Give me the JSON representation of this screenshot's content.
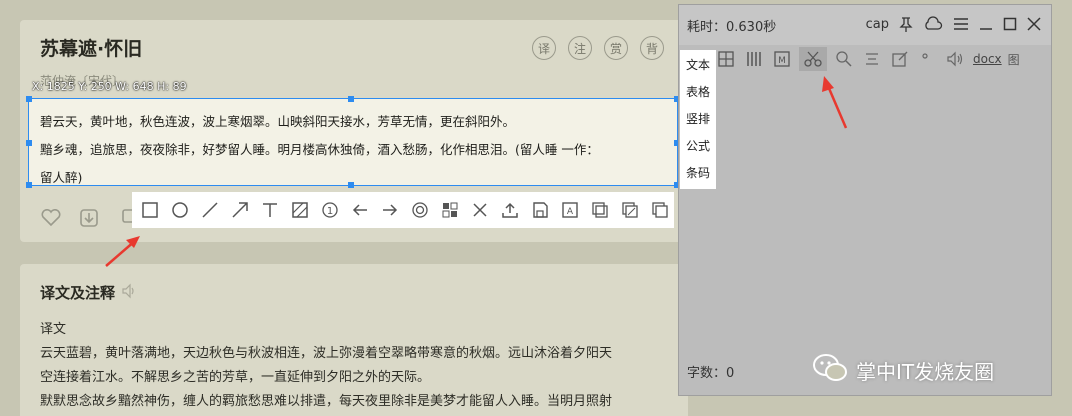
{
  "poem": {
    "title": "苏幕遮·怀旧",
    "author": "范仲淹〔宋代〕",
    "buttons": [
      "译",
      "注",
      "赏",
      "背"
    ],
    "selection_info": "X: 1825 Y: 250 W: 648 H: 89",
    "lines": [
      "碧云天，黄叶地，秋色连波，波上寒烟翠。山映斜阳天接水，芳草无情，更在斜阳外。",
      "黯乡魂，追旅思，夜夜除非，好梦留人睡。明月楼高休独倚，酒入愁肠，化作相思泪。(留人睡 一作：",
      "留人醉)"
    ]
  },
  "translation": {
    "title": "译文及注释",
    "lines": [
      "译文",
      "云天蓝碧，黄叶落满地，天边秋色与秋波相连，波上弥漫着空翠略带寒意的秋烟。远山沐浴着夕阳天",
      "空连接着江水。不解思乡之苦的芳草，一直延伸到夕阳之外的天际。",
      "默默思念故乡黯然神伤，缠人的羁旅愁思难以排遣，每天夜里除非是美梦才能留人入睡。当明月照射"
    ]
  },
  "capture": {
    "time": "耗时：0.630秒",
    "cap_label": "cap",
    "docx_label": "docx",
    "overflow_label": "图",
    "char_count": "字数：0",
    "modes": [
      "文本",
      "表格",
      "竖排",
      "公式",
      "条码"
    ]
  },
  "watermark": "掌中IT发烧友圈",
  "colors": {
    "selection": "#2d8cf0",
    "arrow": "#e8392f"
  }
}
